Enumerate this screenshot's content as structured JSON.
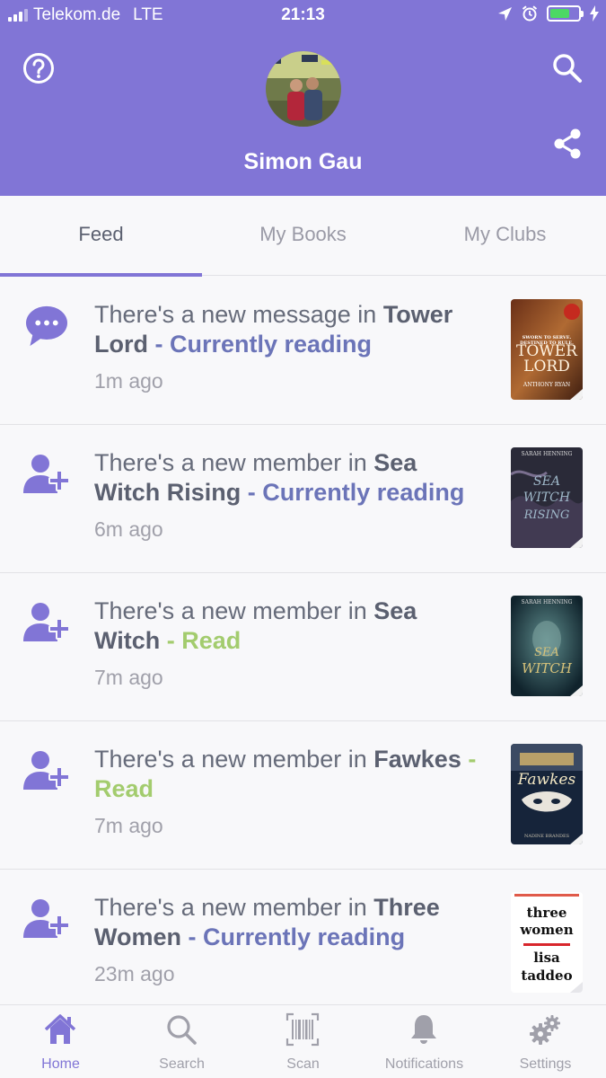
{
  "status_bar": {
    "carrier": "Telekom.de",
    "network": "LTE",
    "time": "21:13",
    "battery_level": 0.7
  },
  "header": {
    "profile_name": "Simon Gau",
    "accent_color": "#8175d6"
  },
  "tabs": [
    {
      "label": "Feed",
      "active": true
    },
    {
      "label": "My Books",
      "active": false
    },
    {
      "label": "My Clubs",
      "active": false
    }
  ],
  "feed": [
    {
      "icon": "chat-bubble-icon",
      "prefix": "There's a new message in ",
      "book": "Tower Lord",
      "separator": " - ",
      "shelf": "Currently reading",
      "time": "1m ago",
      "cover": {
        "top_text": "SWORN TO SERVE. DESTINED TO RULE.",
        "title_line1": "TOWER",
        "title_line2": "LORD",
        "author": "ANTHONY RYAN"
      }
    },
    {
      "icon": "add-user-icon",
      "prefix": "There's a new member in ",
      "book": "Sea Witch Rising",
      "separator": " - ",
      "shelf": "Currently reading",
      "time": "6m ago",
      "cover": {
        "top_text": "SARAH HENNING",
        "title_line1": "SEA",
        "title_line2": "WITCH",
        "title_line3": "RISING"
      }
    },
    {
      "icon": "add-user-icon",
      "prefix": "There's a new member in ",
      "book": "Sea Witch",
      "separator": " - ",
      "shelf": "Read",
      "time": "7m ago",
      "cover": {
        "top_text": "SARAH HENNING",
        "title_line1": "SEA",
        "title_line2": "WITCH"
      }
    },
    {
      "icon": "add-user-icon",
      "prefix": "There's a new member in ",
      "book": "Fawkes",
      "separator": " - ",
      "shelf": "Read",
      "time": "7m ago",
      "cover": {
        "title_line1": "Fawkes",
        "author": "NADINE BRANDES"
      }
    },
    {
      "icon": "add-user-icon",
      "prefix": "There's a new member in ",
      "book": "Three Women",
      "separator": " - ",
      "shelf": "Currently reading",
      "time": "23m ago",
      "cover": {
        "title_line1": "three",
        "title_line2": "women",
        "title_line3": "lisa",
        "title_line4": "taddeo"
      }
    }
  ],
  "bottom_nav": [
    {
      "label": "Home",
      "icon": "home-icon",
      "active": true
    },
    {
      "label": "Search",
      "icon": "search-icon",
      "active": false
    },
    {
      "label": "Scan",
      "icon": "barcode-icon",
      "active": false
    },
    {
      "label": "Notifications",
      "icon": "bell-icon",
      "active": false
    },
    {
      "label": "Settings",
      "icon": "gear-icon",
      "active": false
    }
  ]
}
